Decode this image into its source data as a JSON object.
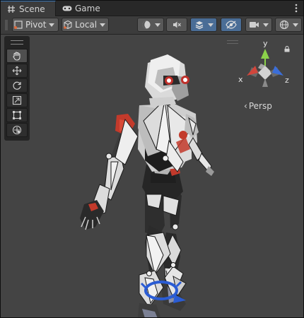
{
  "tabs": [
    {
      "label": "Scene",
      "icon": "scene-grid-icon",
      "active": true
    },
    {
      "label": "Game",
      "icon": "game-controller-icon",
      "active": false
    }
  ],
  "toolbar": {
    "pivot_label": "Pivot",
    "local_label": "Local"
  },
  "tools": [
    {
      "name": "hand-tool",
      "icon": "hand-icon"
    },
    {
      "name": "move-tool",
      "icon": "move-arrows-icon"
    },
    {
      "name": "rotate-tool",
      "icon": "rotate-icon"
    },
    {
      "name": "scale-tool",
      "icon": "scale-icon"
    },
    {
      "name": "rect-tool",
      "icon": "rect-icon"
    },
    {
      "name": "transform-tool",
      "icon": "transform-icon"
    }
  ],
  "gizmo": {
    "x_label": "x",
    "y_label": "y",
    "z_label": "z",
    "projection_label": "Persp",
    "x_color": "#d0463c",
    "y_color": "#8bd24a",
    "z_color": "#3b6ed8"
  },
  "colors": {
    "accent_blue": "#4a6d96",
    "viewport_bg": "#444444"
  }
}
